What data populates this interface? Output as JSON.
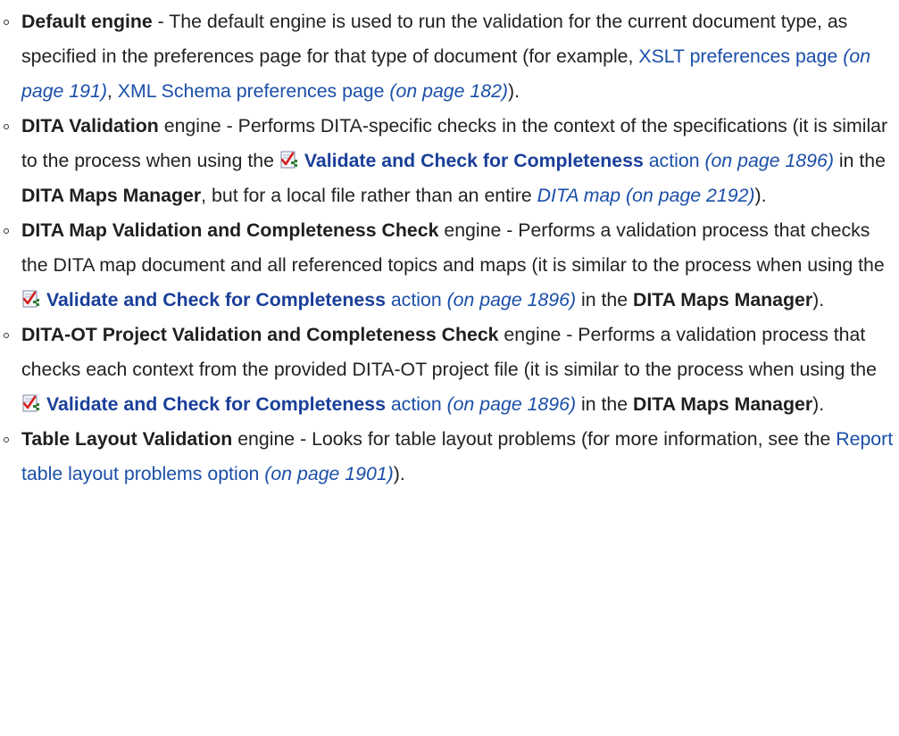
{
  "items": [
    {
      "name": "Default engine",
      "desc_a": " - The default engine is used to run the validation for the current document type, as specified in the preferences page for that type of document (for example, ",
      "link1": "XSLT preferences page",
      "ref1": " (on page 191)",
      "sep": ", ",
      "link2": "XML Schema preferences page",
      "ref2": " (on page 182)",
      "end": ")."
    },
    {
      "name": "DITA Validation",
      "desc_a": " engine - Performs DITA-specific checks in the context of the specifications (it is similar to the process when using the ",
      "action_label": "Validate and Check for Completeness",
      "action_suffix": " action",
      "ref": " (on page 1896)",
      "in_the": " in the ",
      "manager": "DITA Maps Manager",
      "desc_b": ", but for a local file rather than an entire ",
      "map_link": "DITA map",
      "map_ref": " (on page 2192)",
      "end": ")."
    },
    {
      "name": "DITA Map Validation and Completeness Check",
      "desc_a": " engine - Performs a validation process that checks the DITA map document and all referenced topics and maps (it is similar to the process when using the ",
      "action_label": "Validate and Check for Completeness",
      "action_suffix": " action",
      "ref": " (on page 1896)",
      "in_the": " in the ",
      "manager": "DITA Maps Manager",
      "end": ")."
    },
    {
      "name": "DITA-OT Project Validation and Completeness Check",
      "desc_a": " engine - Performs a validation process that checks each context from the provided DITA-OT project file (it is similar to the process when using the ",
      "action_label": "Validate and Check for Completeness",
      "action_suffix": " action",
      "ref": " (on page 1896)",
      "in_the": " in the ",
      "manager": "DITA Maps Manager",
      "end": ")."
    },
    {
      "name": "Table Layout Validation",
      "desc_a": " engine - Looks for table layout problems (for more information, see the ",
      "link": "Report table layout problems option",
      "ref": " (on page 1901)",
      "end": ")."
    }
  ],
  "icon": "validate-check-icon",
  "colors": {
    "link": "#1a4fa8",
    "text": "#222222"
  }
}
